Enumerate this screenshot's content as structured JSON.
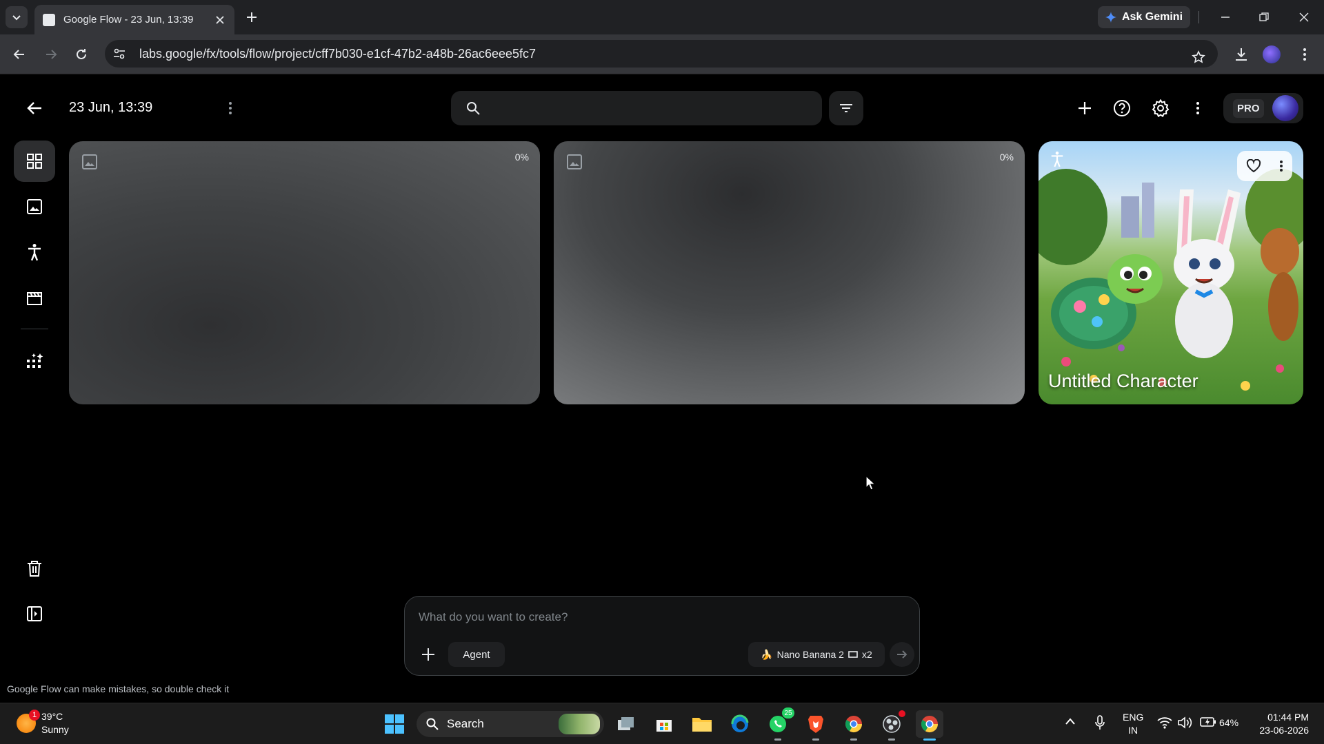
{
  "browser": {
    "tab_title": "Google Flow - 23 Jun, 13:39",
    "url": "labs.google/fx/tools/flow/project/cff7b030-e1cf-47b2-a48b-26ac6eee5fc7",
    "ask_gemini_label": "Ask Gemini"
  },
  "header": {
    "project_title": "23 Jun, 13:39",
    "search_placeholder": "",
    "pro_label": "PRO"
  },
  "rail": {
    "items": [
      "grid-view",
      "images",
      "characters",
      "scenes",
      "tools"
    ],
    "active": "grid-view"
  },
  "cards": [
    {
      "type": "loading",
      "progress": "0%"
    },
    {
      "type": "loading",
      "progress": "0%"
    },
    {
      "type": "character",
      "name": "Untitled Character"
    }
  ],
  "composer": {
    "placeholder": "What do you want to create?",
    "agent_label": "Agent",
    "model_label": "Nano Banana 2",
    "count_label": "x2"
  },
  "disclaimer": "Google Flow can make mistakes, so double check it",
  "taskbar": {
    "temperature": "39°C",
    "weather": "Sunny",
    "weather_badge": "1",
    "search_label": "Search",
    "whatsapp_badge": "25",
    "language_line1": "ENG",
    "language_line2": "IN",
    "battery": "64%",
    "time": "01:44 PM",
    "date": "23-06-2026"
  }
}
